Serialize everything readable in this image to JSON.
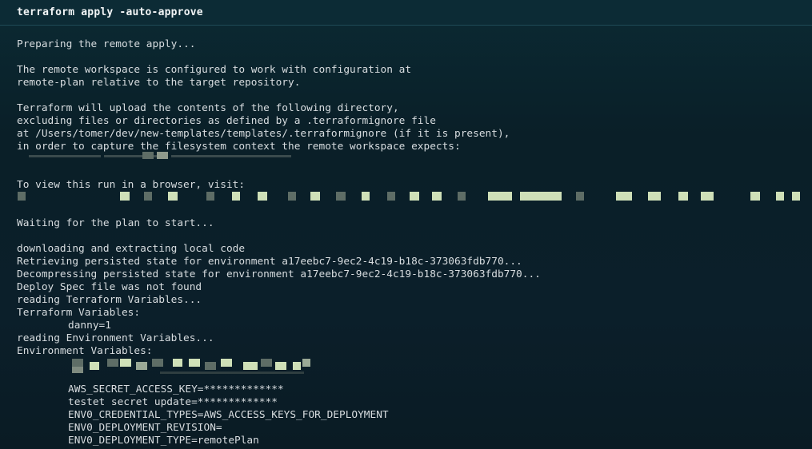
{
  "window": {
    "title": "terraform apply -auto-approve"
  },
  "log": {
    "l01": "Preparing the remote apply...",
    "l03": "The remote workspace is configured to work with configuration at",
    "l04": "remote-plan relative to the target repository.",
    "l06": "Terraform will upload the contents of the following directory,",
    "l07": "excluding files or directories as defined by a .terraformignore file",
    "l08": "at /Users/tomer/dev/new-templates/templates/.terraformignore (if it is present),",
    "l09": "in order to capture the filesystem context the remote workspace expects:",
    "l12": "To view this run in a browser, visit:",
    "l15": "Waiting for the plan to start...",
    "l17": "downloading and extracting local code",
    "l18": "Retrieving persisted state for environment a17eebc7-9ec2-4c19-b18c-373063fdb770...",
    "l19": "Decompressing persisted state for environment a17eebc7-9ec2-4c19-b18c-373063fdb770...",
    "l20": "Deploy Spec file was not found",
    "l21": "reading Terraform Variables...",
    "l22": "Terraform Variables:",
    "l23": "danny=1",
    "l24": "reading Environment Variables...",
    "l25": "Environment Variables:",
    "l28": "AWS_SECRET_ACCESS_KEY=*************",
    "l29": "testet secret update=*************",
    "l30": "ENV0_CREDENTIAL_TYPES=AWS_ACCESS_KEYS_FOR_DEPLOYMENT",
    "l31": "ENV0_DEPLOYMENT_REVISION=",
    "l32": "ENV0_DEPLOYMENT_TYPE=remotePlan"
  },
  "colors": {
    "background": "#0b1f2a",
    "text": "#d8dde0",
    "title": "#f2f5f6",
    "redaction_light": "#cfe0b8",
    "redaction_dark": "#5e6d66"
  }
}
